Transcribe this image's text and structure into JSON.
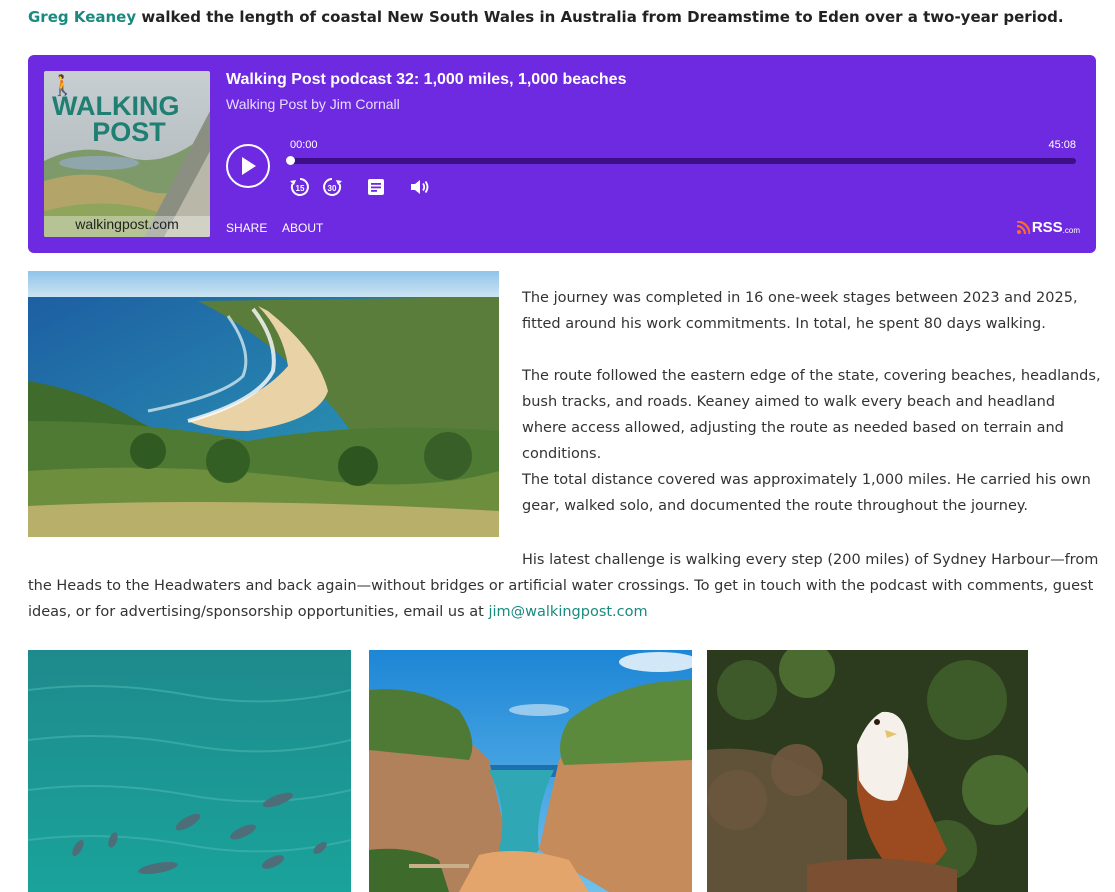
{
  "intro": {
    "link_text": "Greg Keaney",
    "text": " walked the length of coastal New South Wales in Australia from Dreamstime to Eden over a two-year period."
  },
  "player": {
    "cover_brand_line1": "WALKING",
    "cover_brand_line2": "POST",
    "cover_url": "walkingpost.com",
    "episode_title": "Walking Post podcast 32: 1,000 miles, 1,000 beaches",
    "show_name": "Walking Post by Jim Cornall",
    "current_time": "00:00",
    "total_time": "45:08",
    "progress_fraction": 0,
    "controls": [
      "play-icon",
      "rewind-15-icon",
      "forward-30-icon",
      "transcript-icon",
      "volume-icon"
    ],
    "rewind_label": "15",
    "forward_label": "30",
    "share_label": "SHARE",
    "about_label": "ABOUT",
    "rss_label": "RSS",
    "rss_suffix": ".com",
    "colors": {
      "background": "#6e2ae0",
      "track": "#3c0f86",
      "rss": "#ff6a2b"
    }
  },
  "article": {
    "para1": "The journey was completed in 16 one-week stages between 2023 and 2025, fitted around his work commitments. In total, he spent 80 days walking.",
    "para2": "The route followed the eastern edge of the state, covering beaches, headlands, bush tracks, and roads. Keaney aimed to walk every beach and headland where access allowed, adjusting the route as needed based on terrain and conditions.",
    "para3": "The total distance covered was approximately 1,000 miles. He carried his own gear, walked solo, and documented the route throughout the journey.",
    "para4": "His latest challenge is walking every step (200 miles) of Sydney Harbour—from the Heads to the Headwaters and back again—without bridges or artificial water crossings. To get in touch with the podcast with comments, guest ideas, or for advertising/sponsorship opportunities, email us at ",
    "email": "jim@walkingpost.com",
    "link_color": "#1a8a80"
  },
  "images": [
    "coastal-headland-beach-photo",
    "dolphins-in-ocean-photo",
    "gorge-beach-photo",
    "brahminy-kite-bird-photo"
  ]
}
